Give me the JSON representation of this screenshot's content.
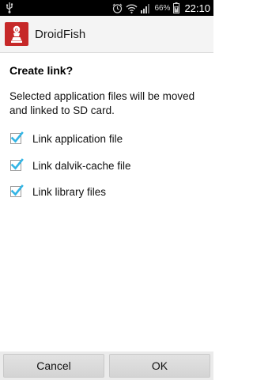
{
  "status_bar": {
    "battery_percent": "66%",
    "time": "22:10",
    "icons": [
      "usb-icon",
      "alarm-icon",
      "wifi-icon",
      "signal-icon",
      "battery-charging-icon"
    ]
  },
  "app": {
    "title": "DroidFish",
    "logo_icon": "chess-pawn-logo-icon",
    "brand_color": "#c62828"
  },
  "dialog": {
    "title": "Create link?",
    "message": "Selected application files will be moved and linked to SD card.",
    "options": [
      {
        "label": "Link application file",
        "checked": true
      },
      {
        "label": "Link dalvik-cache file",
        "checked": true
      },
      {
        "label": "Link library files",
        "checked": true
      }
    ],
    "accent_color": "#33b5e5"
  },
  "buttons": {
    "cancel_label": "Cancel",
    "ok_label": "OK"
  }
}
